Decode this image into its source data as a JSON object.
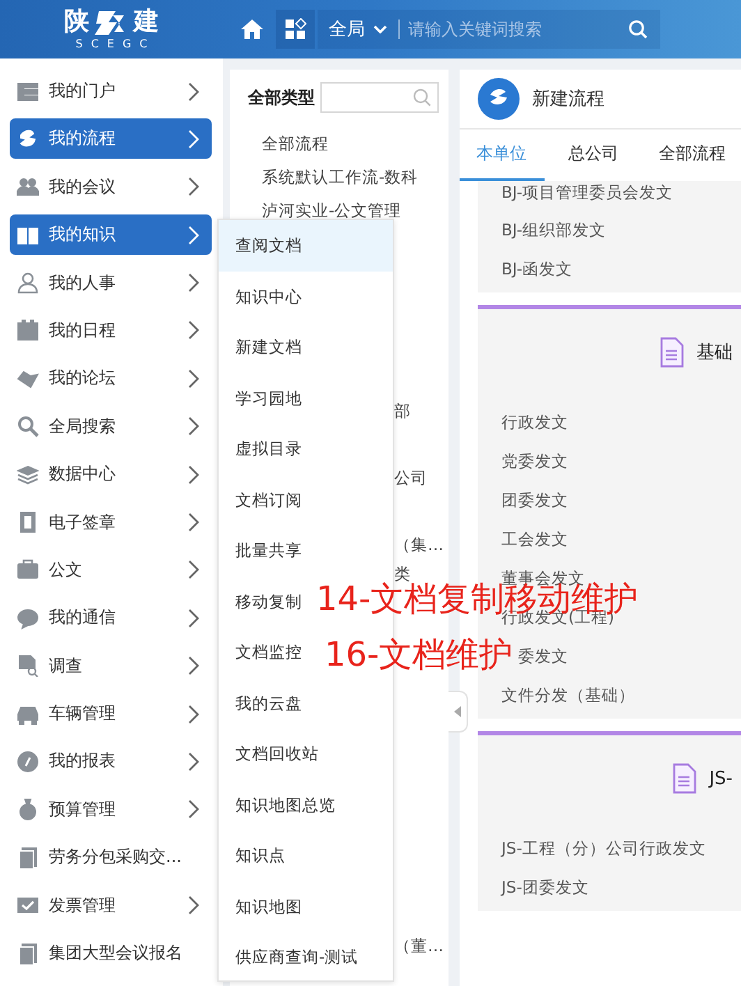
{
  "header": {
    "logo": {
      "left": "陕",
      "right": "建",
      "sub": "SCEGC"
    },
    "scope": "全局",
    "search": {
      "placeholder": "请输入关键词搜索"
    }
  },
  "sidebar": {
    "items": [
      {
        "label": "我的门户",
        "active": false,
        "has_submenu": true
      },
      {
        "label": "我的流程",
        "active": true,
        "has_submenu": true
      },
      {
        "label": "我的会议",
        "active": false,
        "has_submenu": true
      },
      {
        "label": "我的知识",
        "active": true,
        "has_submenu": true
      },
      {
        "label": "我的人事",
        "active": false,
        "has_submenu": true
      },
      {
        "label": "我的日程",
        "active": false,
        "has_submenu": true
      },
      {
        "label": "我的论坛",
        "active": false,
        "has_submenu": true
      },
      {
        "label": "全局搜索",
        "active": false,
        "has_submenu": true
      },
      {
        "label": "数据中心",
        "active": false,
        "has_submenu": true
      },
      {
        "label": "电子签章",
        "active": false,
        "has_submenu": true
      },
      {
        "label": "公文",
        "active": false,
        "has_submenu": true
      },
      {
        "label": "我的通信",
        "active": false,
        "has_submenu": true
      },
      {
        "label": "调查",
        "active": false,
        "has_submenu": true
      },
      {
        "label": "车辆管理",
        "active": false,
        "has_submenu": true
      },
      {
        "label": "我的报表",
        "active": false,
        "has_submenu": true
      },
      {
        "label": "预算管理",
        "active": false,
        "has_submenu": true
      },
      {
        "label": "劳务分包采购交...",
        "active": false,
        "has_submenu": false
      },
      {
        "label": "发票管理",
        "active": false,
        "has_submenu": true
      },
      {
        "label": "集团大型会议报名",
        "active": false,
        "has_submenu": false
      }
    ]
  },
  "type_panel": {
    "title": "全部类型",
    "rows": [
      {
        "text": "全部流程",
        "kind": "full"
      },
      {
        "text": "系统默认工作流-数科",
        "kind": "full"
      },
      {
        "text": "泸河实业-公文管理",
        "kind": "full"
      },
      {
        "text": "部",
        "kind": "tail"
      },
      {
        "text": "公司",
        "kind": "tail"
      },
      {
        "text": "（集…",
        "kind": "tail"
      },
      {
        "text": "类",
        "kind": "tail"
      },
      {
        "text": "（董…",
        "kind": "tail"
      }
    ]
  },
  "submenu": {
    "items": [
      {
        "label": "查阅文档",
        "selected": true
      },
      {
        "label": "知识中心",
        "selected": false
      },
      {
        "label": "新建文档",
        "selected": false
      },
      {
        "label": "学习园地",
        "selected": false
      },
      {
        "label": "虚拟目录",
        "selected": false
      },
      {
        "label": "文档订阅",
        "selected": false
      },
      {
        "label": "批量共享",
        "selected": false
      },
      {
        "label": "移动复制",
        "selected": false
      },
      {
        "label": "文档监控",
        "selected": false
      },
      {
        "label": "我的云盘",
        "selected": false
      },
      {
        "label": "文档回收站",
        "selected": false
      },
      {
        "label": "知识地图总览",
        "selected": false
      },
      {
        "label": "知识点",
        "selected": false
      },
      {
        "label": "知识地图",
        "selected": false
      },
      {
        "label": "供应商查询-测试",
        "selected": false
      }
    ]
  },
  "main": {
    "title": "新建流程",
    "tabs": [
      {
        "label": "本单位",
        "selected": true
      },
      {
        "label": "总公司",
        "selected": false
      },
      {
        "label": "全部流程",
        "selected": false
      }
    ],
    "cards": [
      {
        "rows": [
          {
            "text": "BJ-项目管理委员会发文",
            "kind": "link"
          },
          {
            "text": "BJ-组织部发文",
            "kind": "link"
          },
          {
            "text": "BJ-函发文",
            "kind": "link"
          }
        ]
      },
      {
        "title": "基础",
        "rows": [
          {
            "text": "行政发文",
            "kind": "link"
          },
          {
            "text": "党委发文",
            "kind": "link"
          },
          {
            "text": "团委发文",
            "kind": "link"
          },
          {
            "text": "工会发文",
            "kind": "link"
          },
          {
            "text": "董事会发文",
            "kind": "link"
          },
          {
            "text": "行政发文(工程)",
            "kind": "link"
          },
          {
            "text": "委发文",
            "kind": "clipped"
          },
          {
            "text": "文件分发（基础）",
            "kind": "link"
          }
        ]
      },
      {
        "title": "JS-",
        "rows": [
          {
            "text": "JS-工程（分）公司行政发文",
            "kind": "link"
          },
          {
            "text": "JS-团委发文",
            "kind": "link"
          }
        ]
      }
    ]
  },
  "annotations": [
    "14-文档复制移动维护",
    "16-文档维护"
  ]
}
